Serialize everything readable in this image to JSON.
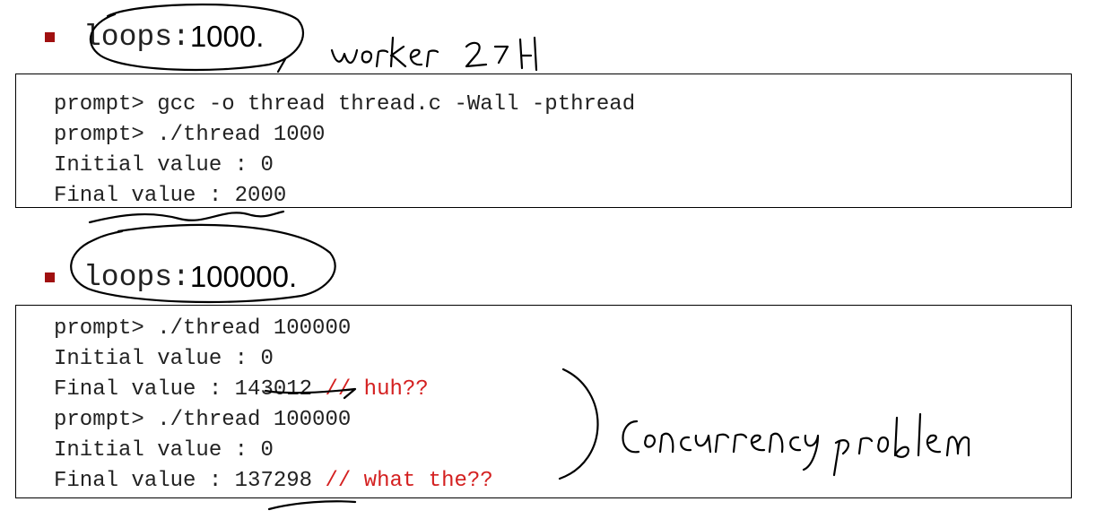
{
  "section1": {
    "keyword": "loops:",
    "value": "1000.",
    "code": [
      {
        "text": "prompt> gcc -o thread thread.c -Wall -pthread",
        "comment": ""
      },
      {
        "text": "prompt> ./thread 1000",
        "comment": ""
      },
      {
        "text": "Initial value : 0",
        "comment": ""
      },
      {
        "text": "Final value : 2000",
        "comment": ""
      }
    ]
  },
  "section2": {
    "keyword": "loops:",
    "value": "100000.",
    "code": [
      {
        "text": "prompt> ./thread 100000",
        "comment": ""
      },
      {
        "text": "Initial value : 0",
        "comment": ""
      },
      {
        "text": "Final value : 143012 ",
        "comment": "// huh??"
      },
      {
        "text": "prompt> ./thread 100000",
        "comment": ""
      },
      {
        "text": "Initial value : 0",
        "comment": ""
      },
      {
        "text": "Final value : 137298 ",
        "comment": "// what the??"
      }
    ]
  },
  "annotations": {
    "note1": "worker 2개",
    "note2": "concurrency problem"
  },
  "colors": {
    "bullet": "#a01010",
    "comment": "#d42020",
    "ink": "#000000"
  }
}
